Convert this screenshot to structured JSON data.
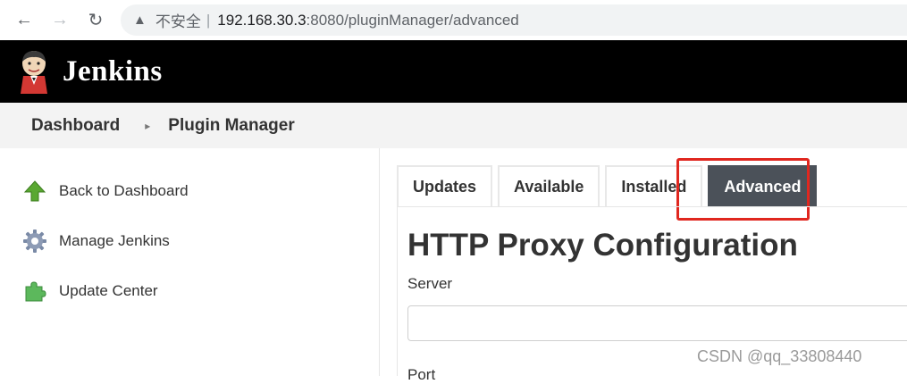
{
  "browser": {
    "warning_icon": "warning-triangle-icon",
    "insecure_label": "不安全",
    "separator": "|",
    "url_host": "192.168.30.3",
    "url_rest": ":8080/pluginManager/advanced"
  },
  "header": {
    "title": "Jenkins",
    "logo_icon": "jenkins-butler-logo"
  },
  "breadcrumb": {
    "items": [
      "Dashboard",
      "Plugin Manager"
    ],
    "separator_icon": "chevron-right-icon"
  },
  "sidebar": {
    "items": [
      {
        "label": "Back to Dashboard",
        "icon": "green-up-arrow-icon"
      },
      {
        "label": "Manage Jenkins",
        "icon": "gear-icon"
      },
      {
        "label": "Update Center",
        "icon": "puzzle-icon"
      }
    ]
  },
  "tabs": [
    {
      "label": "Updates",
      "active": false
    },
    {
      "label": "Available",
      "active": false
    },
    {
      "label": "Installed",
      "active": false
    },
    {
      "label": "Advanced",
      "active": true
    }
  ],
  "colors": {
    "active_tab": "#4b5159",
    "highlight_border": "#e0271f",
    "header_bg": "#000000"
  },
  "main": {
    "title": "HTTP Proxy Configuration",
    "server_label": "Server",
    "server_value": "",
    "port_label": "Port"
  },
  "watermark": "CSDN @qq_33808440"
}
